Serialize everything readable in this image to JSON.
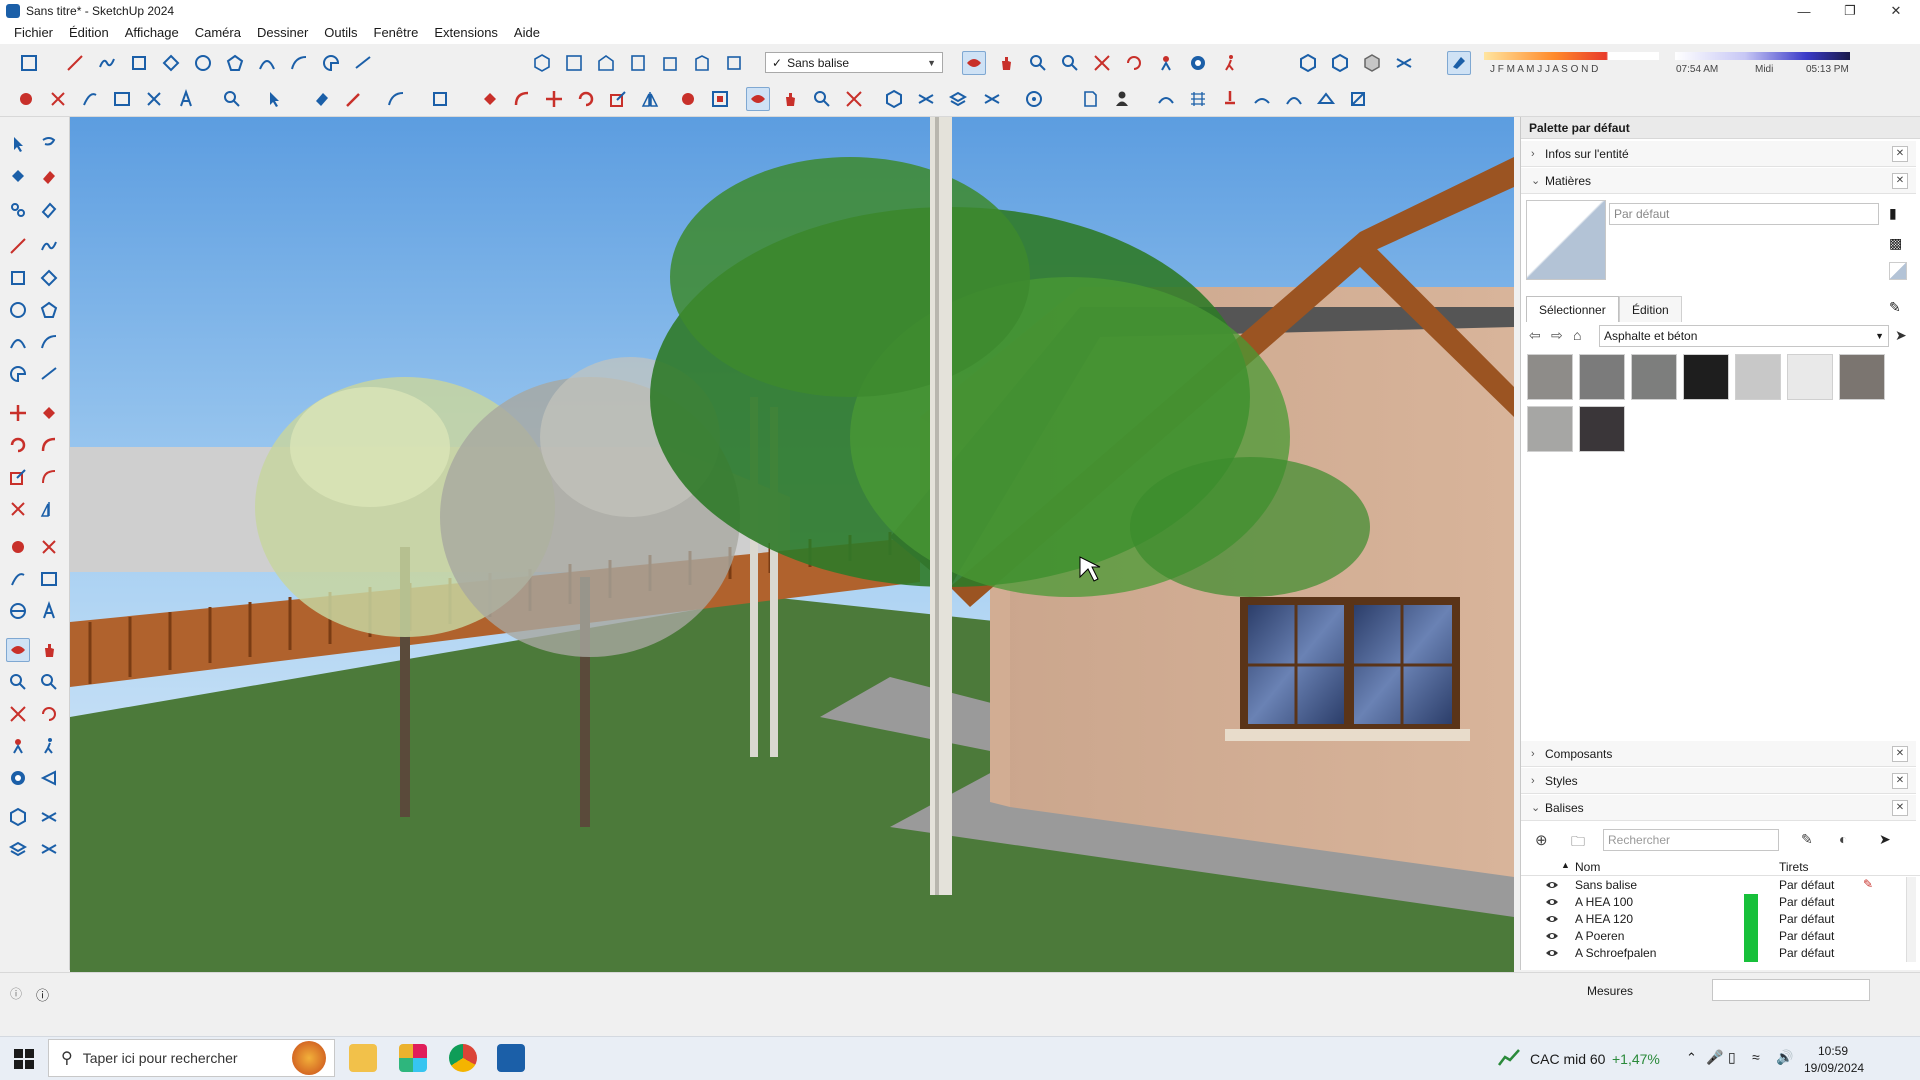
{
  "window": {
    "title": "Sans titre* - SketchUp 2024"
  },
  "menu": [
    "Fichier",
    "Édition",
    "Affichage",
    "Caméra",
    "Dessiner",
    "Outils",
    "Fenêtre",
    "Extensions",
    "Aide"
  ],
  "toolbar": {
    "tag_select": "Sans balise",
    "months": "J F M A M J J A S O N D",
    "time_start": "07:54 AM",
    "time_mid": "Midi",
    "time_end": "05:13 PM"
  },
  "tray": {
    "title": "Palette par défaut",
    "sections": {
      "entity": "Infos sur l'entité",
      "materials": "Matières",
      "components": "Composants",
      "styles": "Styles",
      "tags": "Balises"
    },
    "materials": {
      "name_placeholder": "Par défaut",
      "tab_select": "Sélectionner",
      "tab_edit": "Édition",
      "library": "Asphalte et béton",
      "swatch_colors": [
        "#8e8c89",
        "#7b7b7b",
        "#7d7e7d",
        "#1e1e1e",
        "#c8c8c8",
        "#e9e9e9",
        "#7b7570",
        "#a6a6a4",
        "#3a3639"
      ]
    },
    "tags": {
      "search_placeholder": "Rechercher",
      "col_name": "Nom",
      "col_dash": "Tirets",
      "rows": [
        {
          "name": "Sans balise",
          "dash": "Par défaut",
          "color": ""
        },
        {
          "name": "A HEA 100",
          "dash": "Par défaut",
          "color": "#17c03a"
        },
        {
          "name": "A HEA 120",
          "dash": "Par défaut",
          "color": "#17c03a"
        },
        {
          "name": "A Poeren",
          "dash": "Par défaut",
          "color": "#17c03a"
        },
        {
          "name": "A Schroefpalen",
          "dash": "Par défaut",
          "color": "#17c03a"
        }
      ]
    }
  },
  "status": {
    "measures_label": "Mesures"
  },
  "taskbar": {
    "search_placeholder": "Taper ici pour rechercher",
    "stock_name": "CAC mid 60",
    "stock_change": "+1,47%",
    "time": "10:59",
    "date": "19/09/2024"
  }
}
